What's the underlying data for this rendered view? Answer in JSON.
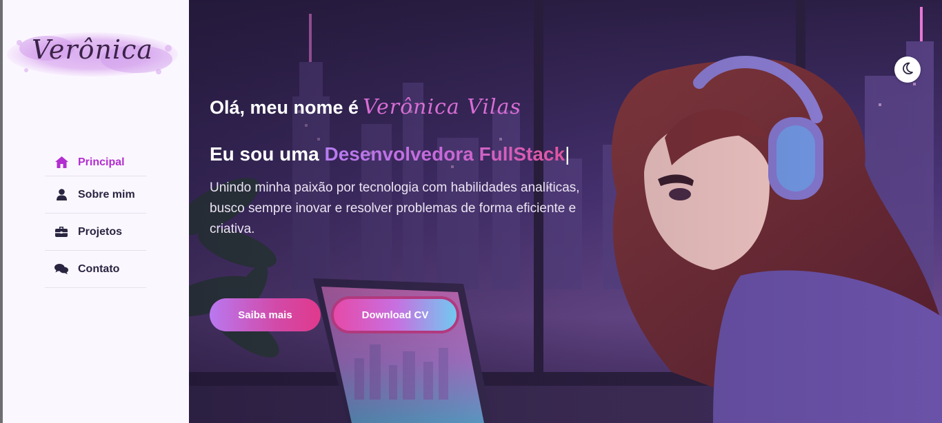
{
  "brand": {
    "logo_text": "Verônica"
  },
  "nav": {
    "items": [
      {
        "label": "Principal",
        "icon": "home-icon",
        "active": true
      },
      {
        "label": "Sobre mim",
        "icon": "user-icon",
        "active": false
      },
      {
        "label": "Projetos",
        "icon": "briefcase-icon",
        "active": false
      },
      {
        "label": "Contato",
        "icon": "chat-icon",
        "active": false
      }
    ]
  },
  "hero": {
    "greeting": "Olá, meu nome é",
    "name": "Verônica Vilas",
    "role_prefix": "Eu sou uma",
    "role_accent": "Desenvolvedora FullStack",
    "caret": "|",
    "description": "Unindo minha paixão por tecnologia com habilidades analíticas, busco sempre inovar e resolver problemas de forma eficiente e criativa.",
    "primary_button": "Saiba mais",
    "secondary_button": "Download CV"
  },
  "theme_toggle": {
    "icon": "moon-icon"
  },
  "colors": {
    "accent": "#b22ecf",
    "sidebar_bg": "#fbf7ff",
    "text_dark": "#2a2540"
  }
}
